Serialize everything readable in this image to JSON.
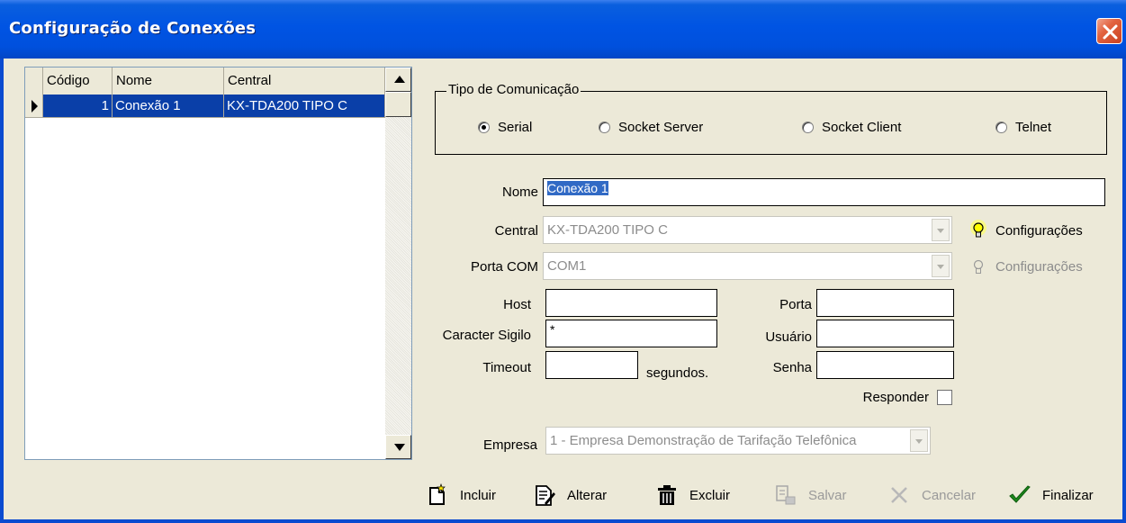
{
  "window": {
    "title": "Configuração de Conexões"
  },
  "grid": {
    "columns": [
      "Código",
      "Nome",
      "Central"
    ],
    "rows": [
      {
        "codigo": "1",
        "nome": "Conexão 1",
        "central": "KX-TDA200 TIPO C"
      }
    ]
  },
  "tipo_comunicacao": {
    "legend": "Tipo de Comunicação",
    "options": [
      {
        "label": "Serial",
        "checked": true
      },
      {
        "label": "Socket Server",
        "checked": false
      },
      {
        "label": "Socket Client",
        "checked": false
      },
      {
        "label": "Telnet",
        "checked": false
      }
    ]
  },
  "form": {
    "nome_label": "Nome",
    "nome_value": "Conexão 1",
    "central_label": "Central",
    "central_value": "KX-TDA200 TIPO C",
    "central_config": "Configurações",
    "porta_com_label": "Porta COM",
    "porta_com_value": "COM1",
    "porta_com_config": "Configurações",
    "host_label": "Host",
    "host_value": "",
    "porta_label": "Porta",
    "porta_value": "",
    "caracter_sigilo_label": "Caracter Sigilo",
    "caracter_sigilo_value": "*",
    "usuario_label": "Usuário",
    "usuario_value": "",
    "timeout_label": "Timeout",
    "timeout_value": "",
    "segundos_label": "segundos.",
    "senha_label": "Senha",
    "senha_value": "",
    "responder_label": "Responder",
    "responder_checked": false,
    "empresa_label": "Empresa",
    "empresa_value": "1 - Empresa Demonstração de Tarifação Telefônica"
  },
  "toolbar": {
    "incluir": "Incluir",
    "alterar": "Alterar",
    "excluir": "Excluir",
    "salvar": "Salvar",
    "cancelar": "Cancelar",
    "finalizar": "Finalizar"
  },
  "colors": {
    "title_bar": "#0054e3",
    "selection": "#0a3fa8",
    "window_bg": "#ece9d8",
    "finalizar_check": "#1c8a1c"
  }
}
